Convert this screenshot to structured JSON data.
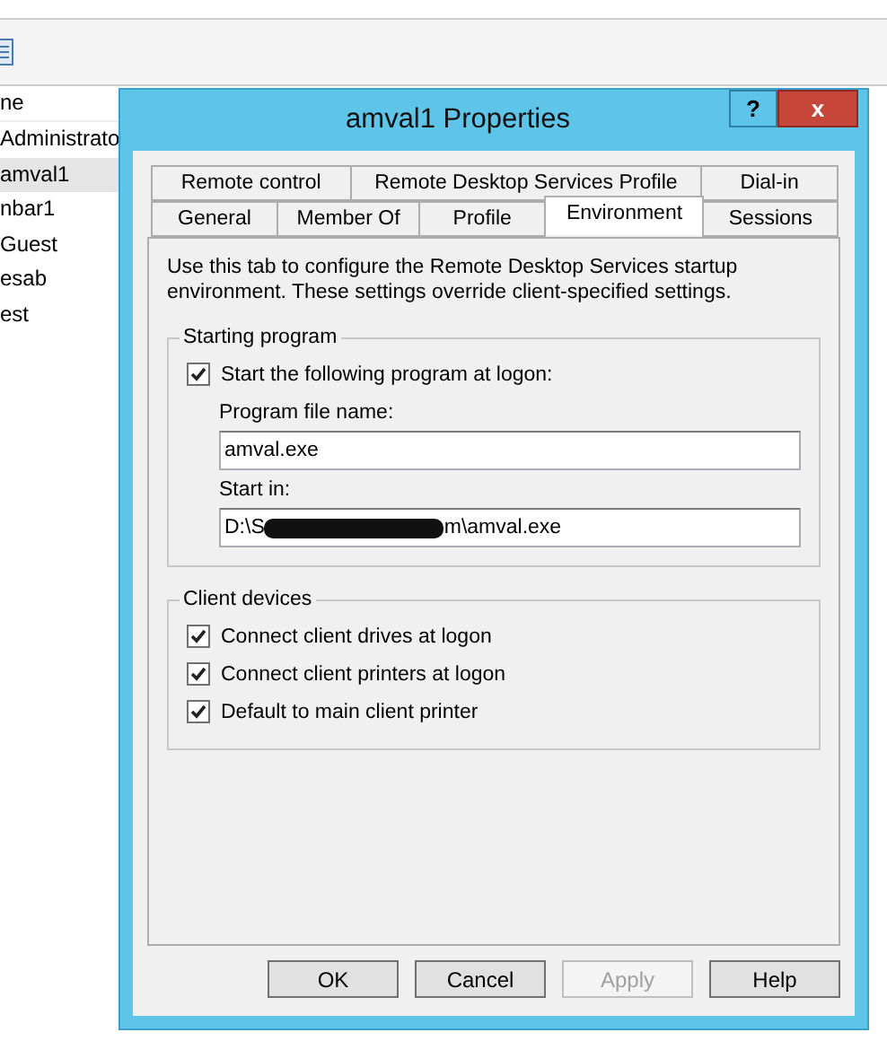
{
  "background_list": {
    "header": "ne",
    "items": [
      {
        "label": "Administrato",
        "selected": false
      },
      {
        "label": "amval1",
        "selected": true
      },
      {
        "label": "nbar1",
        "selected": false
      },
      {
        "label": "Guest",
        "selected": false
      },
      {
        "label": "esab",
        "selected": false
      },
      {
        "label": "est",
        "selected": false
      }
    ]
  },
  "window": {
    "title": "amval1 Properties",
    "help_button": "?",
    "close_button": "x"
  },
  "tab_rows": [
    [
      {
        "label": "Remote control",
        "selected": false
      },
      {
        "label": "Remote Desktop Services Profile",
        "selected": false
      },
      {
        "label": "Dial-in",
        "selected": false
      }
    ],
    [
      {
        "label": "General",
        "selected": false
      },
      {
        "label": "Member Of",
        "selected": false
      },
      {
        "label": "Profile",
        "selected": false
      },
      {
        "label": "Environment",
        "selected": true
      },
      {
        "label": "Sessions",
        "selected": false
      }
    ]
  ],
  "description": "Use this tab to configure the Remote Desktop Services startup environment. These settings override client-specified settings.",
  "starting_program": {
    "title": "Starting program",
    "checkbox": {
      "label": "Start the following program at logon:",
      "checked": true
    },
    "fields": [
      {
        "label": "Program file name:",
        "value": "amval.exe",
        "redacted": false
      },
      {
        "label": "Start in:",
        "value": "D:\\S",
        "value_end": "m\\amval.exe",
        "redacted": true
      }
    ]
  },
  "client_devices": {
    "title": "Client devices",
    "checkboxes": [
      {
        "label": "Connect client drives at logon",
        "checked": true
      },
      {
        "label": "Connect client printers at logon",
        "checked": true
      },
      {
        "label": "Default to main client printer",
        "checked": true
      }
    ]
  },
  "buttons": [
    {
      "label": "OK",
      "disabled": false
    },
    {
      "label": "Cancel",
      "disabled": false
    },
    {
      "label": "Apply",
      "disabled": true
    },
    {
      "label": "Help",
      "disabled": false
    }
  ]
}
